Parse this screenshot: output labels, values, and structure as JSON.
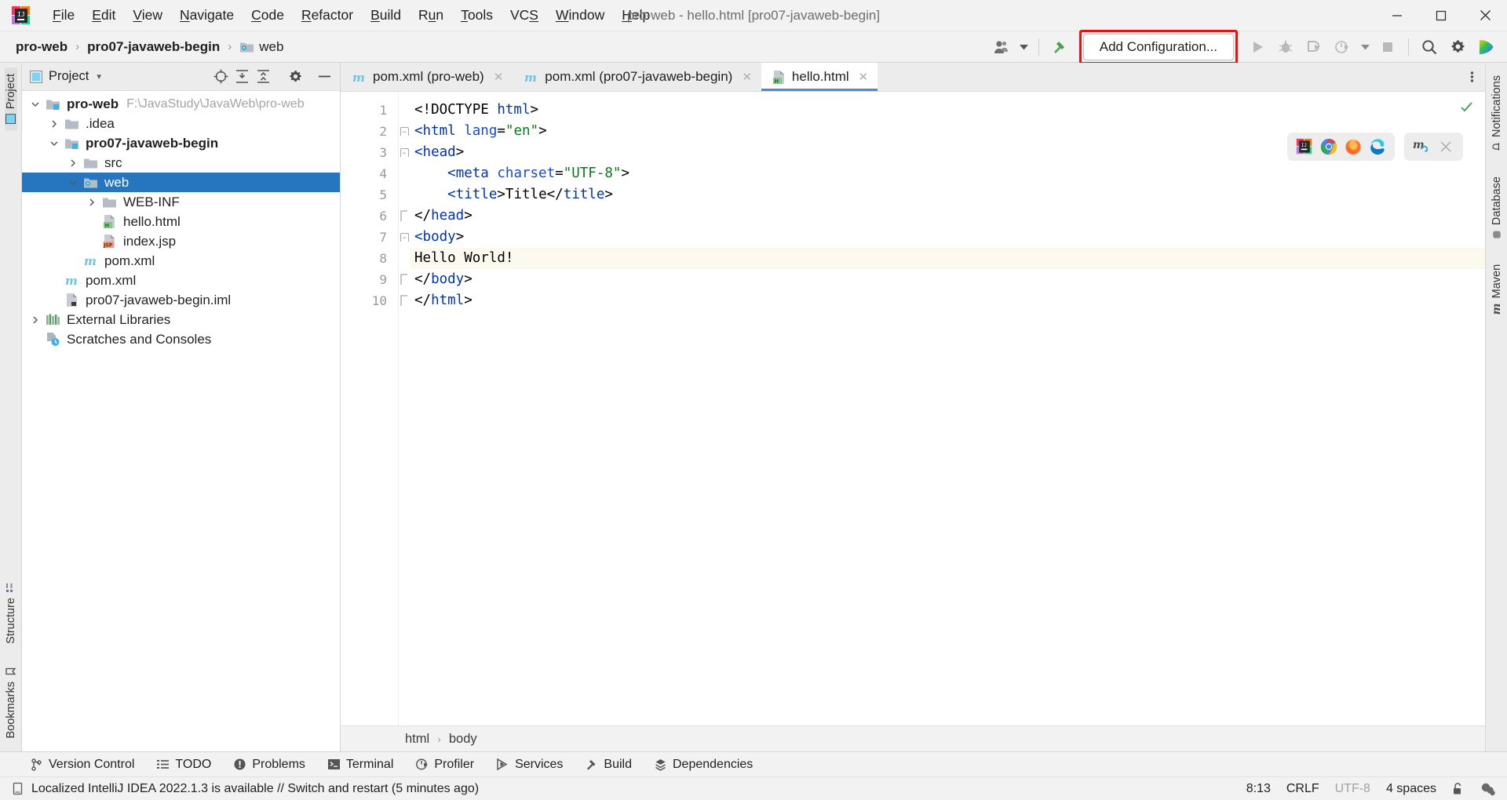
{
  "window": {
    "title": "pro-web - hello.html [pro07-javaweb-begin]",
    "logo_name": "intellij-idea-logo",
    "minimize": "—",
    "maximize": "☐",
    "close": "✕"
  },
  "menu": {
    "items": [
      {
        "label": "File",
        "mnemonic": "F"
      },
      {
        "label": "Edit",
        "mnemonic": "E"
      },
      {
        "label": "View",
        "mnemonic": "V"
      },
      {
        "label": "Navigate",
        "mnemonic": "N"
      },
      {
        "label": "Code",
        "mnemonic": "C"
      },
      {
        "label": "Refactor",
        "mnemonic": "R"
      },
      {
        "label": "Build",
        "mnemonic": "B"
      },
      {
        "label": "Run",
        "mnemonic": "u"
      },
      {
        "label": "Tools",
        "mnemonic": "T"
      },
      {
        "label": "VCS",
        "mnemonic": "S"
      },
      {
        "label": "Window",
        "mnemonic": "W"
      },
      {
        "label": "Help",
        "mnemonic": "H"
      }
    ]
  },
  "toolbar": {
    "breadcrumbs": [
      {
        "label": "pro-web",
        "bold": true,
        "icon": null
      },
      {
        "label": "pro07-javaweb-begin",
        "bold": true,
        "icon": null
      },
      {
        "label": "web",
        "bold": false,
        "icon": "web-folder-icon"
      }
    ],
    "separator": "›",
    "add_configuration_label": "Add Configuration...",
    "highlight_color": "#ee1111",
    "icons": [
      {
        "name": "user-accounts-icon"
      },
      {
        "name": "build-hammer-icon"
      },
      {
        "name": "run-icon"
      },
      {
        "name": "debug-icon"
      },
      {
        "name": "run-with-coverage-icon"
      },
      {
        "name": "profiler-icon"
      },
      {
        "name": "dropdown-caret-icon"
      },
      {
        "name": "stop-icon"
      },
      {
        "name": "search-everywhere-icon"
      },
      {
        "name": "settings-gear-icon"
      },
      {
        "name": "ide-feature-trainer-icon"
      }
    ]
  },
  "left_stripe": {
    "top": [
      {
        "label": "Project",
        "active": true
      }
    ],
    "bottom": [
      {
        "label": "Structure"
      },
      {
        "label": "Bookmarks"
      }
    ]
  },
  "right_stripe": {
    "items": [
      {
        "label": "Notifications"
      },
      {
        "label": "Database"
      },
      {
        "label": "Maven"
      }
    ]
  },
  "project_panel": {
    "title": "Project",
    "view_caret": "▾",
    "actions": [
      {
        "name": "select-opened-file-icon"
      },
      {
        "name": "expand-all-icon"
      },
      {
        "name": "collapse-all-icon"
      },
      {
        "name": "settings-gear-icon"
      },
      {
        "name": "hide-panel-icon"
      }
    ],
    "tree": [
      {
        "indent": 0,
        "arrow": "down",
        "icon": "module-folder-icon",
        "label": "pro-web",
        "bold": true,
        "path": "F:\\JavaStudy\\JavaWeb\\pro-web",
        "selected": false
      },
      {
        "indent": 1,
        "arrow": "right",
        "icon": "folder-icon",
        "label": ".idea",
        "bold": false,
        "path": "",
        "selected": false
      },
      {
        "indent": 1,
        "arrow": "down",
        "icon": "module-folder-icon",
        "label": "pro07-javaweb-begin",
        "bold": true,
        "path": "",
        "selected": false
      },
      {
        "indent": 2,
        "arrow": "right",
        "icon": "folder-icon",
        "label": "src",
        "bold": false,
        "path": "",
        "selected": false
      },
      {
        "indent": 2,
        "arrow": "down",
        "icon": "web-folder-icon",
        "label": "web",
        "bold": false,
        "path": "",
        "selected": true
      },
      {
        "indent": 3,
        "arrow": "right",
        "icon": "folder-icon",
        "label": "WEB-INF",
        "bold": false,
        "path": "",
        "selected": false
      },
      {
        "indent": 3,
        "arrow": "none",
        "icon": "html-file-icon",
        "label": "hello.html",
        "bold": false,
        "path": "",
        "selected": false
      },
      {
        "indent": 3,
        "arrow": "none",
        "icon": "jsp-file-icon",
        "label": "index.jsp",
        "bold": false,
        "path": "",
        "selected": false
      },
      {
        "indent": 2,
        "arrow": "none",
        "icon": "maven-pom-icon",
        "label": "pom.xml",
        "bold": false,
        "path": "",
        "selected": false
      },
      {
        "indent": 1,
        "arrow": "none",
        "icon": "maven-pom-icon",
        "label": "pom.xml",
        "bold": false,
        "path": "",
        "selected": false
      },
      {
        "indent": 1,
        "arrow": "none",
        "icon": "iml-file-icon",
        "label": "pro07-javaweb-begin.iml",
        "bold": false,
        "path": "",
        "selected": false
      },
      {
        "indent": 0,
        "arrow": "right",
        "icon": "external-libraries-icon",
        "label": "External Libraries",
        "bold": false,
        "path": "",
        "selected": false
      },
      {
        "indent": 0,
        "arrow": "none",
        "icon": "scratches-icon",
        "label": "Scratches and Consoles",
        "bold": false,
        "path": "",
        "selected": false
      }
    ]
  },
  "editor": {
    "tabs": [
      {
        "label": "pom.xml (pro-web)",
        "icon": "maven-pom-icon",
        "active": false,
        "close": "✕"
      },
      {
        "label": "pom.xml (pro07-javaweb-begin)",
        "icon": "maven-pom-icon",
        "active": false,
        "close": "✕"
      },
      {
        "label": "hello.html",
        "icon": "html-file-icon",
        "active": true,
        "close": "✕"
      }
    ],
    "tab_options_icon": "more-options-icon",
    "inspection_status": "ok-check-icon",
    "line_numbers": [
      1,
      2,
      3,
      4,
      5,
      6,
      7,
      8,
      9,
      10
    ],
    "current_line": 8,
    "lines": [
      {
        "n": 1,
        "fold": "none",
        "tokens": [
          {
            "t": "<!DOCTYPE ",
            "c": "doctype"
          },
          {
            "t": "html",
            "c": "tag"
          },
          {
            "t": ">",
            "c": "punc"
          }
        ]
      },
      {
        "n": 2,
        "fold": "start",
        "tokens": [
          {
            "t": "<",
            "c": "tag"
          },
          {
            "t": "html ",
            "c": "tag"
          },
          {
            "t": "lang",
            "c": "attr"
          },
          {
            "t": "=",
            "c": "punc"
          },
          {
            "t": "\"en\"",
            "c": "str"
          },
          {
            "t": ">",
            "c": "punc"
          }
        ]
      },
      {
        "n": 3,
        "fold": "start",
        "tokens": [
          {
            "t": "<",
            "c": "tag"
          },
          {
            "t": "head",
            "c": "tag"
          },
          {
            "t": ">",
            "c": "punc"
          }
        ]
      },
      {
        "n": 4,
        "fold": "none",
        "tokens": [
          {
            "t": "    <",
            "c": "tag"
          },
          {
            "t": "meta ",
            "c": "tag"
          },
          {
            "t": "charset",
            "c": "attr"
          },
          {
            "t": "=",
            "c": "punc"
          },
          {
            "t": "\"UTF-8\"",
            "c": "str"
          },
          {
            "t": ">",
            "c": "punc"
          }
        ]
      },
      {
        "n": 5,
        "fold": "none",
        "tokens": [
          {
            "t": "    <",
            "c": "tag"
          },
          {
            "t": "title",
            "c": "tag"
          },
          {
            "t": ">",
            "c": "punc"
          },
          {
            "t": "Title",
            "c": "txt"
          },
          {
            "t": "</",
            "c": "punc"
          },
          {
            "t": "title",
            "c": "tag"
          },
          {
            "t": ">",
            "c": "punc"
          }
        ]
      },
      {
        "n": 6,
        "fold": "end",
        "tokens": [
          {
            "t": "</",
            "c": "punc"
          },
          {
            "t": "head",
            "c": "tag"
          },
          {
            "t": ">",
            "c": "punc"
          }
        ]
      },
      {
        "n": 7,
        "fold": "start",
        "tokens": [
          {
            "t": "<",
            "c": "tag"
          },
          {
            "t": "body",
            "c": "tag"
          },
          {
            "t": ">",
            "c": "punc"
          }
        ]
      },
      {
        "n": 8,
        "fold": "none",
        "tokens": [
          {
            "t": "Hello World!",
            "c": "txt"
          }
        ]
      },
      {
        "n": 9,
        "fold": "end",
        "tokens": [
          {
            "t": "</",
            "c": "punc"
          },
          {
            "t": "body",
            "c": "tag"
          },
          {
            "t": ">",
            "c": "punc"
          }
        ]
      },
      {
        "n": 10,
        "fold": "end",
        "tokens": [
          {
            "t": "</",
            "c": "punc"
          },
          {
            "t": "html",
            "c": "tag"
          },
          {
            "t": ">",
            "c": "punc"
          }
        ]
      }
    ],
    "browser_buttons": [
      {
        "name": "intellij-builtin-preview-icon"
      },
      {
        "name": "google-chrome-icon"
      },
      {
        "name": "firefox-icon"
      },
      {
        "name": "microsoft-edge-icon"
      }
    ],
    "secondary_buttons": [
      {
        "name": "markdown-refresh-icon"
      },
      {
        "name": "close-icon",
        "label": "✕"
      }
    ],
    "breadcrumb": [
      "html",
      "body"
    ],
    "breadcrumb_sep": "›"
  },
  "tool_windows": [
    {
      "label": "Version Control",
      "icon": "branch-icon"
    },
    {
      "label": "TODO",
      "icon": "todo-list-icon"
    },
    {
      "label": "Problems",
      "icon": "problems-icon"
    },
    {
      "label": "Terminal",
      "icon": "terminal-icon"
    },
    {
      "label": "Profiler",
      "icon": "profiler-icon"
    },
    {
      "label": "Services",
      "icon": "services-icon"
    },
    {
      "label": "Build",
      "icon": "build-hammer-icon"
    },
    {
      "label": "Dependencies",
      "icon": "dependencies-icon"
    }
  ],
  "status_bar": {
    "message_icon": "ide-notification-icon",
    "message": "Localized IntelliJ IDEA 2022.1.3 is available // Switch and restart (5 minutes ago)",
    "caret_position": "8:13",
    "line_separator": "CRLF",
    "encoding": "UTF-8",
    "indent": "4 spaces",
    "lock_icon": "unlocked-padlock-icon",
    "inspections_icon": "inspection-level-icon"
  }
}
